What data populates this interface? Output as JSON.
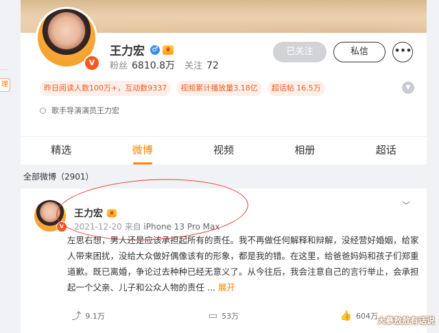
{
  "sidebar": {
    "tab_label": "理"
  },
  "profile": {
    "name": "王力宏",
    "verified_badge": "V",
    "crown_badge": "♛",
    "followers_label": "粉丝",
    "followers_count": "6810.8万",
    "following_label": "关注",
    "following_count": "72",
    "followed_button": "已关注",
    "message_button": "私信",
    "more_button": "•••",
    "tags": [
      "昨日阅读人数100万+，互动数9337",
      "视频累计播放量3.18亿",
      "超话帖 16.5万"
    ],
    "bio": "歌手导演演员王力宏"
  },
  "tabs": [
    "精选",
    "微博",
    "视频",
    "相册",
    "超话"
  ],
  "active_tab_index": 1,
  "feed": {
    "all_posts_label": "全部微博（2901）"
  },
  "post": {
    "author": "王力宏",
    "date": "2021-12-20",
    "from_label": "来自",
    "source": "iPhone 13 Pro Max",
    "text": "左思右想，男人还是应该承担起所有的责任。我不再做任何解释和辩解，没经营好婚姻，给家人带来困扰，没给大众做好偶像该有的形象，都是我的错。在这里，给爸爸妈妈和孩子们郑重道歉。既已离婚，争论过去种种已经无意义了。从今往后，我会注意自己的言行举止，会承担起一个父亲、儿子和公众人物的责任 ...",
    "expand_label": "展开",
    "reposts": "9.1万",
    "comments": "53万",
    "likes": "604万"
  },
  "watermark": "大蔘敖敖有话说",
  "colors": {
    "accent": "#ff8200",
    "badge": "#f25a1f",
    "annotation": "#e23b3b"
  }
}
